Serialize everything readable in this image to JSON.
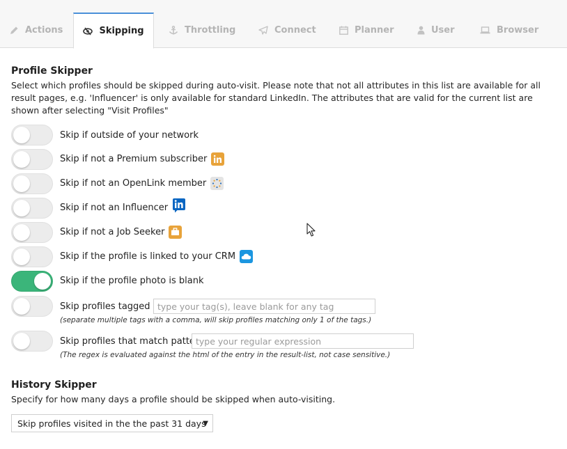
{
  "tabs": [
    {
      "label": "Actions",
      "icon": "pencil-icon"
    },
    {
      "label": "Skipping",
      "icon": "eye-slash-icon",
      "active": true
    },
    {
      "label": "Throttling",
      "icon": "anchor-icon"
    },
    {
      "label": "Connect",
      "icon": "paper-plane-icon"
    },
    {
      "label": "Planner",
      "icon": "calendar-icon"
    },
    {
      "label": "User",
      "icon": "user-icon"
    },
    {
      "label": "Browser",
      "icon": "laptop-icon"
    }
  ],
  "profile_skipper": {
    "title": "Profile Skipper",
    "description": "Select which profiles should be skipped during auto-visit. Please note that not all attributes in this list are available for all result pages, e.g. 'Influencer' is only available for standard LinkedIn. The attributes that are valid for the current list are shown after selecting \"Visit Profiles\"",
    "options": [
      {
        "label": "Skip if outside of your network",
        "on": false
      },
      {
        "label": "Skip if not a Premium subscriber",
        "on": false,
        "icon": "premium-linkedin-icon"
      },
      {
        "label": "Skip if not an OpenLink member",
        "on": false,
        "icon": "openlink-icon"
      },
      {
        "label": "Skip if not an Influencer",
        "on": false,
        "icon": "influencer-linkedin-icon"
      },
      {
        "label": "Skip if not a Job Seeker",
        "on": false,
        "icon": "job-seeker-icon"
      },
      {
        "label": "Skip if the profile is linked to your CRM",
        "on": false,
        "icon": "crm-cloud-icon"
      },
      {
        "label": "Skip if the profile photo is blank",
        "on": true
      }
    ],
    "tagged": {
      "label": "Skip profiles tagged as",
      "placeholder": "type your tag(s), leave blank for any tag",
      "value": "",
      "hint": "(separate multiple tags with a comma, will skip profiles matching only 1 of the tags.)",
      "on": false
    },
    "pattern": {
      "label": "Skip profiles that match pattern",
      "placeholder": "type your regular expression",
      "value": "",
      "hint": "(The regex is evaluated against the html of the entry in the result-list, not case sensitive.)",
      "on": false
    }
  },
  "history_skipper": {
    "title": "History Skipper",
    "description": "Specify for how many days a profile should be skipped when auto-visiting.",
    "selected": "Skip profiles visited in the the past 31 days"
  },
  "colors": {
    "toggle_on": "#3bb57a",
    "active_tab_accent": "#4a90d9",
    "premium_gold": "#e8a33a",
    "linkedin_blue": "#0a66c2",
    "crm_blue": "#1b96e0"
  }
}
